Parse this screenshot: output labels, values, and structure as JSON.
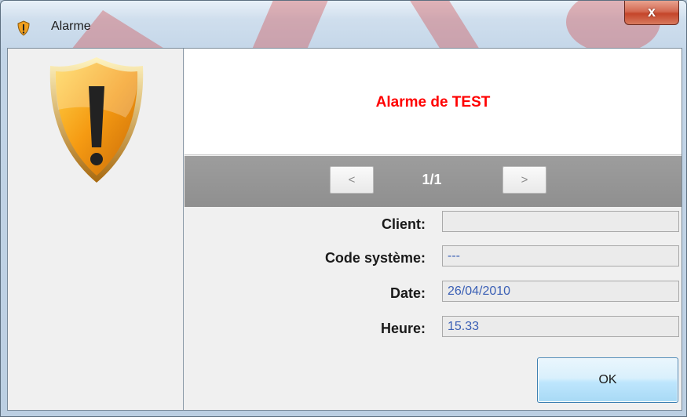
{
  "window": {
    "title": "Alarme",
    "close_label": "x"
  },
  "banner": {
    "message": "Alarme de TEST",
    "color": "#ff0000"
  },
  "navigation": {
    "prev_label": "<",
    "next_label": ">",
    "counter": "1/1"
  },
  "fields": {
    "client": {
      "label": "Client:",
      "value": ""
    },
    "code": {
      "label": "Code système:",
      "value": "---"
    },
    "date": {
      "label": "Date:",
      "value": "26/04/2010"
    },
    "heure": {
      "label": "Heure:",
      "value": "15.33"
    }
  },
  "ok_button": {
    "label": "OK"
  },
  "icons": {
    "title": "shield-warning-icon",
    "main": "shield-warning-icon"
  }
}
